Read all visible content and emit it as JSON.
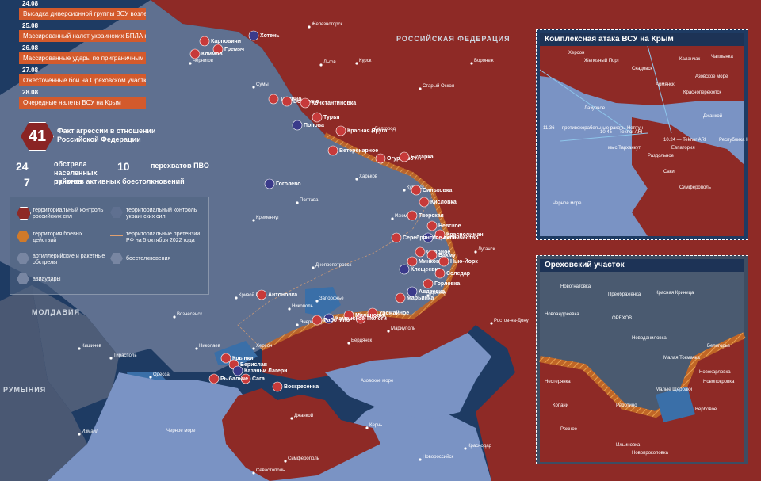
{
  "timeline": [
    {
      "date": "24.08",
      "text": "Высадка диверсионной группы ВСУ возле мыса Тарханкут"
    },
    {
      "date": "25.08",
      "text": "Массированный налет украинских БПЛА на Крым"
    },
    {
      "date": "26.08",
      "text": "Массированные удары по приграничным областям"
    },
    {
      "date": "27.08",
      "text": "Ожесточенные бои на Ореховском участке"
    },
    {
      "date": "28.08",
      "text": "Очередные налеты ВСУ на Крым"
    }
  ],
  "stats": {
    "aggression_count": "41",
    "aggression_label": "Факт агрессии в отношении Российской Федерации",
    "shelling_count": "24",
    "shelling_label": "обстрела населенных пунктов",
    "intercepts_count": "10",
    "intercepts_label": "перехватов ПВО",
    "districts_count": "7",
    "districts_label": "районов активных боестолкновений"
  },
  "legend": {
    "ru_control": "территориальный контроль российских сил",
    "ua_control": "территориальный контроль украинских сил",
    "combat_zone": "территория боевых действий",
    "claims": "территориальные претензии РФ на 5 октября 2022 года",
    "artillery": "артиллерийские и ракетные обстрелы",
    "clashes": "боестолкновения",
    "airstrikes": "авиаудары"
  },
  "colors": {
    "ru": "#8e2a26",
    "ua": "#5d6f8d",
    "sea": "#7a93c4",
    "combat": "#d07a2a",
    "ukr_blue": "#3a6fa8",
    "marker": "#c73a3a"
  },
  "countries": {
    "russia": "РОССИЙСКАЯ ФЕДЕРАЦИЯ",
    "moldova": "МОЛДАВИЯ",
    "romania": "РУМЫНИЯ"
  },
  "seas": {
    "azov": "Азовское море",
    "black": "Черное море"
  },
  "cities": [
    [
      "Железногорск",
      390,
      34
    ],
    [
      "Курск",
      450,
      80
    ],
    [
      "Льгов",
      405,
      82
    ],
    [
      "Старый Оскол",
      530,
      112
    ],
    [
      "Воронеж",
      595,
      80
    ],
    [
      "Белгород",
      470,
      166
    ],
    [
      "Харьков",
      450,
      226
    ],
    [
      "Полтава",
      375,
      256
    ],
    [
      "Кременчуг",
      320,
      278
    ],
    [
      "Днепропетровск",
      395,
      338
    ],
    [
      "Запорожье",
      400,
      380
    ],
    [
      "Энергодар",
      375,
      410
    ],
    [
      "Никополь",
      365,
      390
    ],
    [
      "Кривой Рог",
      298,
      376
    ],
    [
      "Вознесенск",
      220,
      400
    ],
    [
      "Николаев",
      248,
      440
    ],
    [
      "Херсон",
      320,
      440
    ],
    [
      "Одесса",
      190,
      476
    ],
    [
      "Кишинев",
      100,
      440
    ],
    [
      "Тирасполь",
      140,
      452
    ],
    [
      "Измаил",
      100,
      548
    ],
    [
      "Джанкой",
      368,
      528
    ],
    [
      "Симферополь",
      360,
      582
    ],
    [
      "Севастополь",
      320,
      597
    ],
    [
      "Керчь",
      463,
      540
    ],
    [
      "Донецк",
      540,
      373
    ],
    [
      "Мариуполь",
      490,
      418
    ],
    [
      "Бердянск",
      440,
      433
    ],
    [
      "Ростов-на-Дону",
      620,
      408
    ],
    [
      "Луганск",
      600,
      318
    ],
    [
      "Изюм",
      495,
      276
    ],
    [
      "Купянск",
      510,
      240
    ],
    [
      "Сумы",
      320,
      110
    ],
    [
      "Чернигов",
      240,
      80
    ],
    [
      "Краснодар",
      587,
      566
    ],
    [
      "Новороссийск",
      530,
      580
    ]
  ],
  "hotspots": [
    "Карповичи",
    "Гремяч",
    "Климов",
    "Хотень",
    "Теткино",
    "Волфино",
    "Константиновка",
    "Турья",
    "Попова",
    "Красная Яруга",
    "Ветеренарное",
    "Огурцово",
    "Бударка",
    "Гоголево",
    "Синьковка",
    "Кисловка",
    "Тверская",
    "Невское",
    "Торское",
    "Краснолиман",
    "Серебрянское лесничество",
    "Спорное",
    "Минковка",
    "Клещеевка",
    "Нью-Йорк",
    "Бахмут",
    "Соледар",
    "Горловка",
    "Авдеевка",
    "Марьинка",
    "Урожайное",
    "Пологи",
    "Малиновка",
    "Каменское",
    "Работино",
    "Антоновка",
    "Берислав",
    "Крынки",
    "Казачьи Лагери",
    "Сага",
    "Рыбальче",
    "Воскресенка"
  ],
  "insets": {
    "crimea": {
      "title": "Комплексная атака ВСУ на Крым",
      "labels": [
        "Железный Порт",
        "Скадовск",
        "Каланчак",
        "Херсон",
        "Чаплынка",
        "Лазурное",
        "Джанкой",
        "Армянск",
        "Красноперекопск",
        "мыс Тарханкут",
        "Евпатория",
        "Саки",
        "Симферополь",
        "Черное море",
        "Республика Крым",
        "11.36 — противокорабельные ракеты Нептун",
        "10.45 — Teknor ARI",
        "10.24 — Teknor ARI",
        "Раздольное",
        "Азовское море"
      ]
    },
    "orekhov": {
      "title": "Ореховский участок",
      "labels": [
        "Новогнатовка",
        "Преображенка",
        "Красная Криница",
        "Новоандреевка",
        "ОРЕХОВ",
        "Новоданиловка",
        "Белогорье",
        "Малая Токмачка",
        "Малые Щербаки",
        "Нестерянка",
        "Копани",
        "Работино",
        "Вербовое",
        "Новопрокоповка",
        "Рожное",
        "Ильиновка",
        "Новокарловка",
        "Новопокровка"
      ]
    }
  }
}
